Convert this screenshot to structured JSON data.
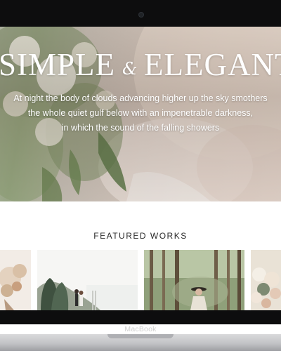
{
  "device": {
    "brand_label": "MacBook"
  },
  "hero": {
    "title_part1": "SIMPLE",
    "ampersand": "&",
    "title_part2": "ELEGANT",
    "tagline_lines": [
      "At night the body of clouds advancing higher up the sky smothers",
      "the whole quiet gulf below with an impenetrable darkness,",
      "in which the sound of the falling showers"
    ]
  },
  "featured": {
    "heading": "FEATURED WORKS",
    "items": [
      {
        "subject": "dried flower bouquet"
      },
      {
        "subject": "couple on hillside with cypress trees"
      },
      {
        "subject": "woman in forest wearing hat"
      },
      {
        "subject": "white and pink rose bouquet"
      }
    ]
  },
  "colors": {
    "bezel": "#0d0d0e",
    "hero_text": "#ffffff",
    "heading_text": "#2b2b2b",
    "page_background": "#ffffff"
  }
}
